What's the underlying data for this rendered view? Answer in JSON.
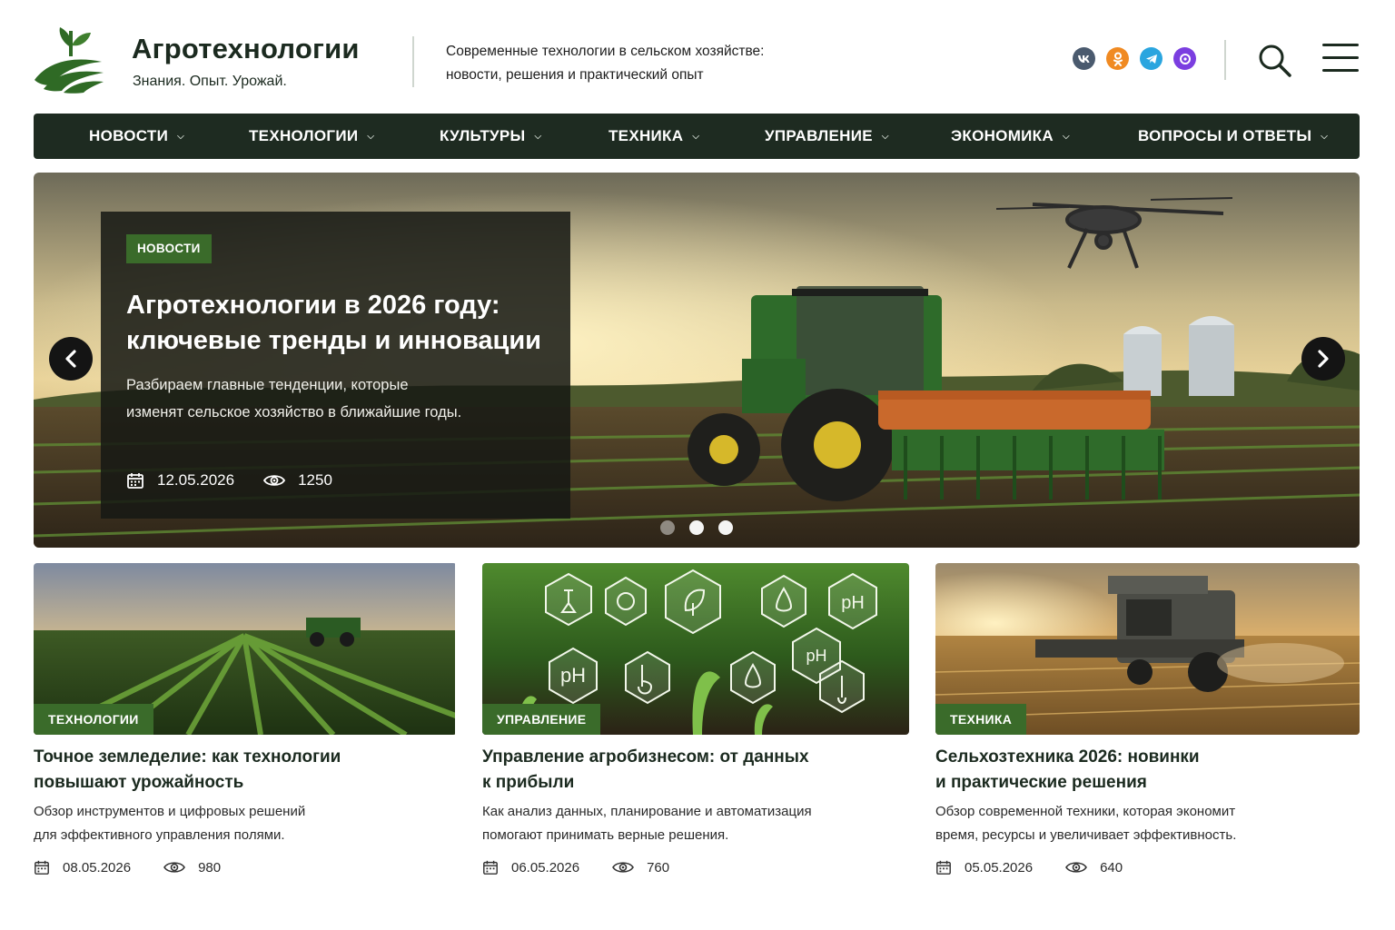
{
  "site": {
    "title": "Агротехнологии",
    "tagline": "Знания. Опыт. Урожай.",
    "description_line1": "Современные технологии в сельском хозяйстве:",
    "description_line2": "новости, решения и практический опыт"
  },
  "socials": [
    {
      "name": "vk-icon",
      "glyph": "vk",
      "color": "#4a5a6e"
    },
    {
      "name": "ok-icon",
      "glyph": "ok",
      "color": "#f08a22"
    },
    {
      "name": "telegram-icon",
      "glyph": "tg",
      "color": "#2aa5df"
    },
    {
      "name": "max-icon",
      "glyph": "max",
      "color": "#7b3ee0"
    }
  ],
  "nav": {
    "items": [
      "НОВОСТИ",
      "ТЕХНОЛОГИИ",
      "КУЛЬТУРЫ",
      "ТЕХНИКА",
      "УПРАВЛЕНИЕ",
      "ЭКОНОМИКА",
      "ВОПРОСЫ И ОТВЕТЫ"
    ]
  },
  "hero": {
    "badge": "НОВОСТИ",
    "title_line1": "Агротехнологии в 2026 году:",
    "title_line2": "ключевые тренды и инновации",
    "text_line1": "Разбираем главные тенденции, которые",
    "text_line2": "изменят сельское хозяйство в ближайшие годы.",
    "date": "12.05.2026",
    "views": "1250",
    "slide_index": 1,
    "slide_count": 3
  },
  "cards": [
    {
      "badge": "ТЕХНОЛОГИИ",
      "title_line1": "Точное земледелие: как технологии",
      "title_line2": "повышают урожайность",
      "text_line1": "Обзор инструментов и цифровых решений",
      "text_line2": "для эффективного управления полями.",
      "date": "08.05.2026",
      "views": "980"
    },
    {
      "badge": "УПРАВЛЕНИЕ",
      "title_line1": "Управление агробизнесом: от данных",
      "title_line2": "к прибыли",
      "text_line1": "Как анализ данных, планирование и автоматизация",
      "text_line2": "помогают принимать верные решения.",
      "date": "06.05.2026",
      "views": "760"
    },
    {
      "badge": "ТЕХНИКА",
      "title_line1": "Сельхозтехника 2026: новинки",
      "title_line2": "и практические решения",
      "text_line1": "Обзор современной техники, которая экономит",
      "text_line2": "время, ресурсы и увеличивает эффективность.",
      "date": "05.05.2026",
      "views": "640"
    }
  ],
  "icons": {
    "ph_label": "pH"
  },
  "colors": {
    "nav_bg": "#1e2b21",
    "badge_green": "#3a6b2a",
    "brand_dark": "#1b2a1f"
  }
}
